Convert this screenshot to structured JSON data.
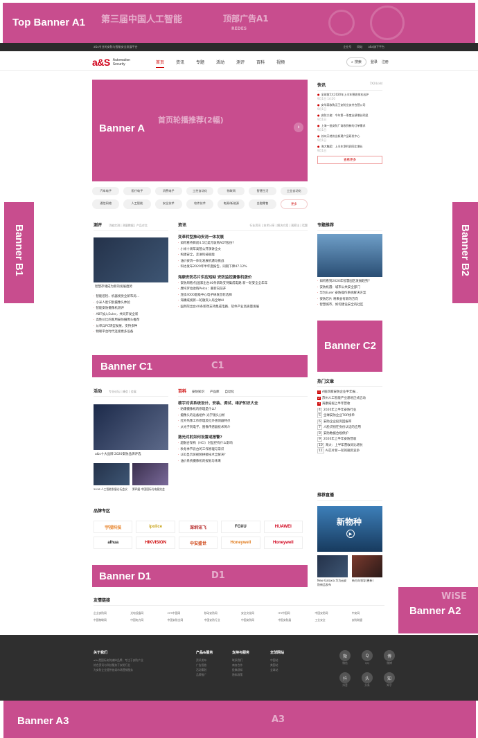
{
  "ads": {
    "top": {
      "label": "Top Banner A1",
      "faint_center": "顶部广告A1",
      "faint_left": "第三届中国人工智能",
      "sub": "REDES"
    },
    "a": {
      "label": "Banner A",
      "faint": "首页轮播推荐(2幅)"
    },
    "b1": {
      "label": "Banner B1"
    },
    "b2": {
      "label": "Banner B2"
    },
    "c1": {
      "label": "Banner C1",
      "faint": "C1"
    },
    "c2": {
      "label": "Banner C2"
    },
    "d1": {
      "label": "Banner D1",
      "faint": "D1"
    },
    "a2": {
      "label": "Banner A2",
      "faint": "WiSE"
    },
    "a3": {
      "label": "Banner A3",
      "faint": "A3"
    }
  },
  "utilbar": {
    "left": "a&s专业的安防与智能安全发展平台",
    "right": [
      "企业号",
      "网站",
      "a&s旗下平台"
    ]
  },
  "logo": {
    "mark": "a&S",
    "line1": "Automation",
    "line2": "Security"
  },
  "nav": {
    "items": [
      "首页",
      "资讯",
      "专题",
      "活动",
      "测评",
      "百科",
      "视频"
    ],
    "active_index": 0
  },
  "nav_right": {
    "search": "搜索",
    "login": "登录",
    "register": "注册"
  },
  "chips": [
    "汽车电子",
    "医疗电子",
    "消费电子",
    "工控自动化",
    "物联网",
    "智慧生活",
    "工业自动化",
    "通信网络",
    "人工智能",
    "安全技术",
    "软件技术",
    "电源/新能源",
    "金融零售",
    "更多"
  ],
  "review": {
    "title": "测评",
    "subtabs": "功能实测 | 测量数据 | 产品对比",
    "img_caption": "智慧存储成为新的发展趋势",
    "items": [
      "智能巡检、机器视觉全新布局...",
      "小米人脸识别摄像头体验",
      "智能安防摄像机测评",
      "ABT加入Euler，共同开发全新",
      "高性价比的家用安防摄像头推荐",
      "从单兵PC转型发展，支持多种",
      "物联平台时代连接更多设备"
    ]
  },
  "news": {
    "title": "资讯",
    "subtabs": "行业资讯 | 技术分享 | 解决方案 | 观察法 | 话题",
    "headline1": "变革转型推动安消一体发展",
    "group1": [
      "如何看待目前4.5亿美元收购ADT股份?",
      "小米十周年高管公开演讲全文",
      "构建安全，走进科技赋能",
      "油价安消一体化发展机遇与挑战",
      "科达发布2020年半年度报告，同期下降47.12%"
    ],
    "headline2": "海康安防芯片供应短缺 安防监控摄像机涨价",
    "group2": [
      "安防周看点|国家出台40条新政支持集成电路 新一轮安全全年年",
      "摩托罗拉收购Pelco：重新向前开",
      "连续4000超级中心电子研发首轮选择",
      "海康威视新一轮融资入局全球AI",
      "国务院出台40条新政支持集成电路、软件产业高质量发展"
    ]
  },
  "flash": {
    "title": "快讯",
    "more": "7X24小时",
    "items": [
      {
        "t": "全球前5大2020年上半年营收排名出炉",
        "d": "9月1日 14:20"
      },
      {
        "t": "安华高收购汉王安防业务并合营公司",
        "d": "9月1日"
      },
      {
        "t": "安防大佬：今年第一季度业绩增长明显",
        "d": "9月1日"
      },
      {
        "t": "上海一批安防厂商收到新的订单需求",
        "d": "9月1日"
      },
      {
        "t": "苏州天地伟业新建产品研发中心",
        "d": "9月1日"
      },
      {
        "t": "海大集团：上半年净利润同比增长",
        "d": "9月1日"
      }
    ],
    "view_more": "查看更多"
  },
  "topic": {
    "title": "专题推荐",
    "items": [
      "如何看到2020年智慧园区发展趋势？",
      "安防机遇：城市公共安全部门",
      "华为Euler 安防操作系统解决方案",
      "安防芯片 将来会有新的方向",
      "智慧城市，如何建设安全的社区"
    ]
  },
  "hot": {
    "title": "热门文章",
    "items": [
      "A股四家安防企业半年报...",
      "苏州人工智能产业基地正式启动",
      "海康威视上半年营收",
      "2020年上半年安防行业",
      "全球安防企业TOP榜单",
      "安防企业投资回报率",
      "人脸识别在身份认证的应用",
      "安防数据合规保护",
      "2020年上半年安防营收",
      "海大：上半年营收同比增长",
      "AI芯片新一轮的融资竞争"
    ]
  },
  "live": {
    "title": "推荐直播",
    "stage_text": "新物种",
    "cards": [
      {
        "t": "New Galaxia 华为云安防新品发布"
      },
      {
        "t": "新方向领导(更新)"
      }
    ]
  },
  "activity": {
    "title": "活动",
    "subtabs": "专业论坛 | 峰会 | 会展",
    "main_caption": "a&s十大品牌 2020安防品牌评选",
    "thumbs": [
      {
        "t": "2018 人工智能发展论坛会议"
      },
      {
        "t": "第四届·中国国际光电展览会"
      }
    ]
  },
  "wiki": {
    "title": "百科",
    "subtabs": [
      "安防知识",
      "产品库",
      "自动化"
    ],
    "headline1": "楼宇对讲系统设计、安装、调试、维护知识大全",
    "group1": [
      "防爆摄像机的原理是什么?",
      "摄像头的设备组件-光学镜头分析",
      "红外热像工作原理及红外感测器特点",
      "从光子到电子，图像传感器技术简介"
    ],
    "headline2": "激光对射如何设置或报警?",
    "group2": [
      "超融合架构（HCI）对监控有什么影响",
      "秋冬季节云台的工作原理与常识",
      "LED显示屏视频拼接技术全解决？",
      "油价系统摄像机的规划与未来"
    ]
  },
  "brands": {
    "title": "品牌专区",
    "items": [
      "宇视科技",
      "ipolice",
      "深圳讯飞",
      "FOXU",
      "HUAWEI",
      "alhua",
      "HIKVISION",
      "中安盛世",
      "Honeywell",
      "Honeywell"
    ]
  },
  "friend": {
    "title": "友情链接",
    "links": [
      "企业安防网",
      "光电设备网",
      "CPS中国网",
      "移动安防网",
      "安全文化网",
      "ITS中国网",
      "中国安防网",
      "中安网",
      "中国物联网",
      "中国电力网",
      "中国安防业网",
      "中国安防行业",
      "中国安防网",
      "中国安防展",
      "工业安全",
      "安防联盟"
    ]
  },
  "footer": {
    "about": {
      "title": "关于我们",
      "lines": [
        "a&s是国际安防媒体品牌，专注于安防产业",
        "综合资讯与科技服务于安防行业",
        "为安防企业提供各类市场营销服务"
      ]
    },
    "service": {
      "title": "产品&服务",
      "lines": [
        "资讯发布",
        "广告投放",
        "活动策划",
        "品牌推广"
      ]
    },
    "support": {
      "title": "支持与服务",
      "lines": [
        "联系我们",
        "商务合作",
        "投稿须知",
        "隐私政策"
      ]
    },
    "global": {
      "title": "全球网站",
      "lines": [
        "中国站",
        "美国站",
        "全球站"
      ]
    },
    "social": [
      {
        "i": "微",
        "c": "微信"
      },
      {
        "i": "Q",
        "c": "QQ"
      },
      {
        "i": "博",
        "c": "微博"
      },
      {
        "i": "抖",
        "c": "抖音"
      },
      {
        "i": "头",
        "c": "头条"
      },
      {
        "i": "知",
        "c": "知乎"
      }
    ]
  }
}
